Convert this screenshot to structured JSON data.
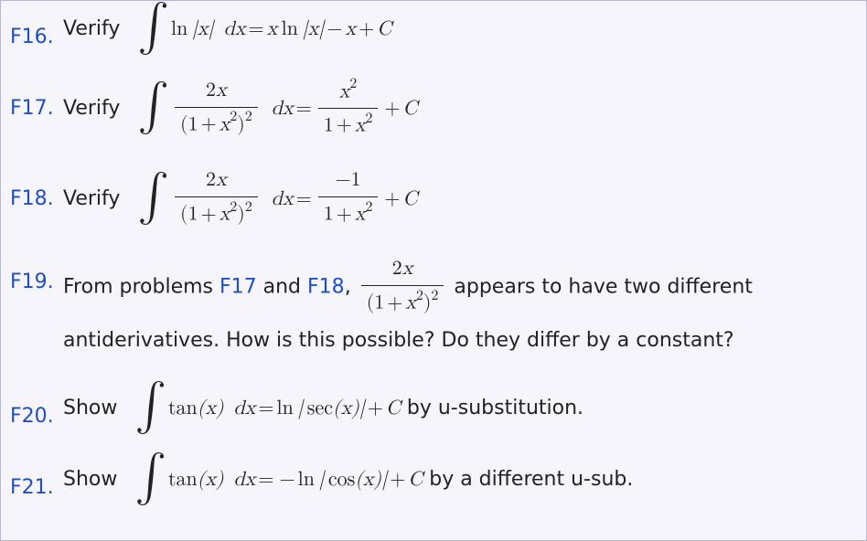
{
  "problems": {
    "p16": {
      "label": "F16.",
      "verb": "Verify",
      "expr_plain": "∫ ln|x| dx = x ln|x| − x + C"
    },
    "p17": {
      "label": "F17.",
      "verb": "Verify",
      "expr_plain": "∫ 2x / (1 + x^2)^2 dx = x^2 / (1 + x^2) + C",
      "frac1_num": "2x",
      "frac1_den": "(1 + x^2)^2",
      "frac2_num": "x^2",
      "frac2_den": "1 + x^2"
    },
    "p18": {
      "label": "F18.",
      "verb": "Verify",
      "expr_plain": "∫ 2x / (1 + x^2)^2 dx = −1 / (1 + x^2) + C",
      "frac1_num": "2x",
      "frac1_den": "(1 + x^2)^2",
      "frac2_num": "−1",
      "frac2_den": "1 + x^2"
    },
    "p19": {
      "label": "F19.",
      "text_before": "From problems ",
      "ref1": "F17",
      "mid1": " and ",
      "ref2": "F18",
      "mid2": ", ",
      "frac_num": "2x",
      "frac_den": "(1 + x^2)^2",
      "text_after1": " appears to have two different",
      "text_line2": "antiderivatives.  How is this possible?  Do they differ by a constant?",
      "expr_plain": "2x / (1 + x^2)^2"
    },
    "p20": {
      "label": "F20.",
      "verb": "Show",
      "expr_plain": "∫ tan(x) dx = ln|sec(x)| + C",
      "tail": " by u-substitution."
    },
    "p21": {
      "label": "F21.",
      "verb": "Show",
      "expr_plain": "∫ tan(x) dx = − ln|cos(x)| + C",
      "tail": " by a different u-sub."
    }
  }
}
